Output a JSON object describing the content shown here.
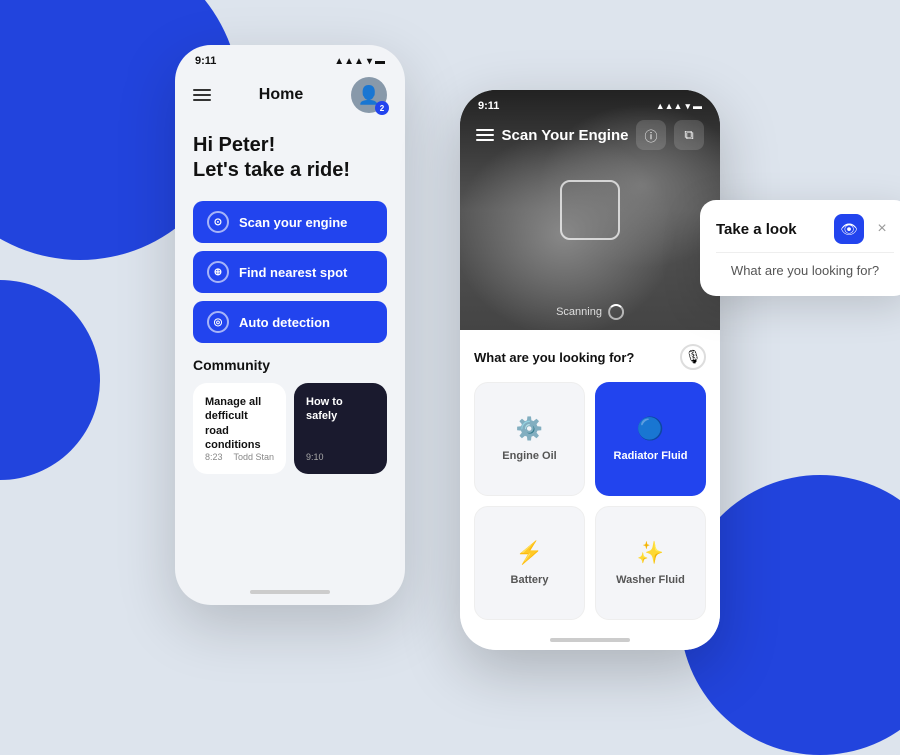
{
  "background": {
    "color": "#dde4ed"
  },
  "phone1": {
    "status_time": "9:11",
    "header_title": "Home",
    "avatar_badge": "2",
    "greeting_line1": "Hi Peter!",
    "greeting_line2": "Let's take a ride!",
    "buttons": [
      {
        "label": "Scan your engine",
        "icon": "⊙"
      },
      {
        "label": "Find nearest spot",
        "icon": "⊕"
      },
      {
        "label": "Auto detection",
        "icon": "◎"
      }
    ],
    "community_title": "Community",
    "community_cards": [
      {
        "type": "light",
        "title": "Manage all defficult road conditions",
        "time": "8:23",
        "author": "Todd Stan"
      },
      {
        "type": "dark",
        "title": "How to safely",
        "time": "9:10"
      }
    ]
  },
  "phone2": {
    "status_time": "9:11",
    "header_title": "Scan Your Engine",
    "scan_status": "Scanning",
    "tooltip": {
      "title": "Take a look",
      "question": "What are you looking for?"
    },
    "bottom_section": {
      "label": "What are you looking for?",
      "options": [
        {
          "label": "Engine Oil",
          "icon": "⚙",
          "style": "light"
        },
        {
          "label": "Radiator Fluid",
          "icon": "◷",
          "style": "blue"
        },
        {
          "label": "Battery",
          "icon": "⚡",
          "style": "light"
        },
        {
          "label": "Washer Fluid",
          "icon": "✧",
          "style": "light"
        }
      ]
    }
  }
}
